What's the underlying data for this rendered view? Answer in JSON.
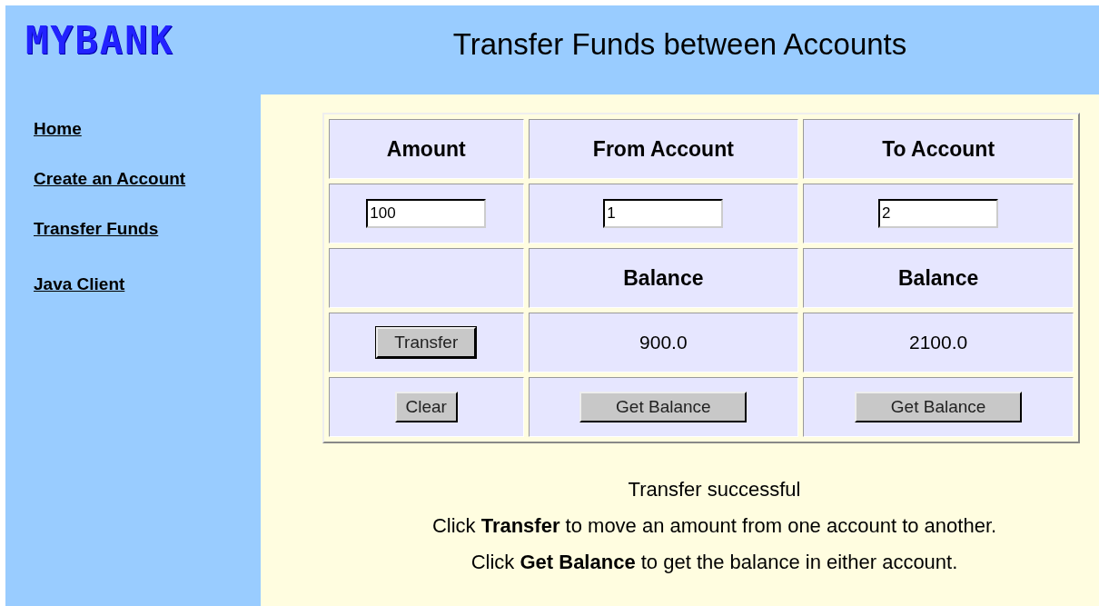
{
  "logo": "MYBANK",
  "title": "Transfer Funds between Accounts",
  "nav": [
    {
      "label": "Home"
    },
    {
      "label": "Create an Account"
    },
    {
      "label": "Transfer Funds"
    },
    {
      "label": "Java Client"
    }
  ],
  "table": {
    "columns": [
      "Amount",
      "From Account",
      "To Account"
    ],
    "fields": [
      "100",
      "1",
      "2"
    ],
    "balance_labels": [
      "Balance",
      "Balance"
    ],
    "transfer_button": "Transfer",
    "balances": [
      "900.0",
      "2100.0"
    ],
    "clear_button": "Clear",
    "get_balance_buttons": [
      "Get Balance",
      "Get Balance"
    ]
  },
  "messages": {
    "status": "Transfer successful",
    "help": [
      "Click **Transfer** to move an amount from one account to another.",
      "Click **Get Balance** to get the balance in either account."
    ]
  }
}
